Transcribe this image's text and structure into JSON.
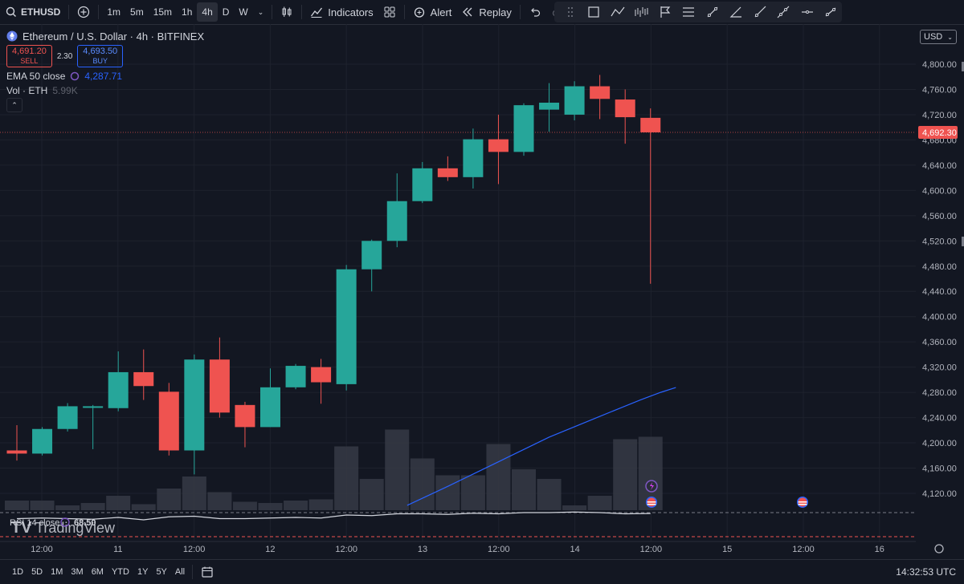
{
  "toolbar": {
    "symbol": "ETHUSD",
    "intervals": [
      "1m",
      "5m",
      "15m",
      "1h",
      "4h",
      "D",
      "W"
    ],
    "active_interval": "4h",
    "indicators_label": "Indicators",
    "alert_label": "Alert",
    "replay_label": "Replay"
  },
  "legend": {
    "title": "Ethereum / U.S. Dollar · 4h · BITFINEX",
    "sell_price": "4,691.20",
    "sell_label": "SELL",
    "spread": "2.30",
    "buy_price": "4,693.50",
    "buy_label": "BUY",
    "ema_label": "EMA 50 close",
    "ema_value": "4,287.71",
    "vol_label": "Vol · ETH",
    "vol_value": "5.99K"
  },
  "rsi": {
    "label": "RSI 14 close",
    "value": "68.50"
  },
  "watermark": "TradingView",
  "currency": "USD",
  "price_axis": [
    "4,800.00",
    "4,760.00",
    "4,720.00",
    "4,680.00",
    "4,640.00",
    "4,600.00",
    "4,560.00",
    "4,520.00",
    "4,480.00",
    "4,440.00",
    "4,400.00",
    "4,360.00",
    "4,320.00",
    "4,280.00",
    "4,240.00",
    "4,200.00",
    "4,160.00",
    "4,120.00"
  ],
  "last_price": "4,692.30",
  "time_axis": [
    "12:00",
    "11",
    "12:00",
    "12",
    "12:00",
    "13",
    "12:00",
    "14",
    "12:00",
    "15",
    "12:00",
    "16"
  ],
  "ranges": [
    "1D",
    "5D",
    "1M",
    "3M",
    "6M",
    "YTD",
    "1Y",
    "5Y",
    "All"
  ],
  "clock": "14:32:53 UTC",
  "colors": {
    "up": "#26a69a",
    "down": "#ef5350",
    "background": "#131722",
    "ema": "#2962ff"
  },
  "chart_data": {
    "type": "candlestick",
    "ylim": [
      4100,
      4820
    ],
    "candles": [
      {
        "o": 4188,
        "h": 4228,
        "l": 4172,
        "c": 4183
      },
      {
        "o": 4183,
        "h": 4225,
        "l": 4180,
        "c": 4222
      },
      {
        "o": 4222,
        "h": 4263,
        "l": 4218,
        "c": 4258
      },
      {
        "o": 4258,
        "h": 4260,
        "l": 4190,
        "c": 4258
      },
      {
        "o": 4255,
        "h": 4345,
        "l": 4250,
        "c": 4312
      },
      {
        "o": 4312,
        "h": 4348,
        "l": 4268,
        "c": 4290
      },
      {
        "o": 4281,
        "h": 4295,
        "l": 4180,
        "c": 4188
      },
      {
        "o": 4188,
        "h": 4340,
        "l": 4150,
        "c": 4332
      },
      {
        "o": 4332,
        "h": 4367,
        "l": 4240,
        "c": 4248
      },
      {
        "o": 4260,
        "h": 4265,
        "l": 4193,
        "c": 4225
      },
      {
        "o": 4225,
        "h": 4318,
        "l": 4225,
        "c": 4288
      },
      {
        "o": 4288,
        "h": 4325,
        "l": 4285,
        "c": 4322
      },
      {
        "o": 4320,
        "h": 4333,
        "l": 4262,
        "c": 4296
      },
      {
        "o": 4293,
        "h": 4482,
        "l": 4283,
        "c": 4475
      },
      {
        "o": 4475,
        "h": 4522,
        "l": 4440,
        "c": 4520
      },
      {
        "o": 4520,
        "h": 4627,
        "l": 4510,
        "c": 4583
      },
      {
        "o": 4583,
        "h": 4645,
        "l": 4580,
        "c": 4635
      },
      {
        "o": 4635,
        "h": 4654,
        "l": 4615,
        "c": 4621
      },
      {
        "o": 4621,
        "h": 4698,
        "l": 4603,
        "c": 4681
      },
      {
        "o": 4681,
        "h": 4720,
        "l": 4610,
        "c": 4661
      },
      {
        "o": 4661,
        "h": 4738,
        "l": 4655,
        "c": 4735
      },
      {
        "o": 4728,
        "h": 4770,
        "l": 4693,
        "c": 4739
      },
      {
        "o": 4720,
        "h": 4773,
        "l": 4711,
        "c": 4765
      },
      {
        "o": 4765,
        "h": 4783,
        "l": 4713,
        "c": 4745
      },
      {
        "o": 4744,
        "h": 4760,
        "l": 4674,
        "c": 4716
      },
      {
        "o": 4715,
        "h": 4730,
        "l": 4452,
        "c": 4692
      }
    ],
    "volume": [
      0.4,
      0.4,
      0.2,
      0.3,
      0.6,
      0.25,
      0.9,
      1.4,
      0.75,
      0.35,
      0.3,
      0.4,
      0.45,
      2.65,
      1.3,
      3.35,
      2.15,
      1.45,
      1.45,
      2.75,
      1.7,
      1.3,
      0.2,
      0.6,
      2.95,
      3.05
    ],
    "ema50": [
      {
        "i": 15.4,
        "v": 4101
      },
      {
        "i": 17,
        "v": 4131
      },
      {
        "i": 19,
        "v": 4170
      },
      {
        "i": 21,
        "v": 4209
      },
      {
        "i": 23,
        "v": 4242
      },
      {
        "i": 24.6,
        "v": 4268
      },
      {
        "i": 25.4,
        "v": 4280
      },
      {
        "i": 26,
        "v": 4287.71
      }
    ],
    "rsi": [
      60,
      61,
      60,
      59,
      62,
      58,
      63,
      64,
      60,
      60,
      61,
      62,
      61,
      66,
      65,
      68,
      68,
      67,
      69,
      68,
      70,
      70,
      71,
      70,
      68,
      68.5
    ]
  }
}
